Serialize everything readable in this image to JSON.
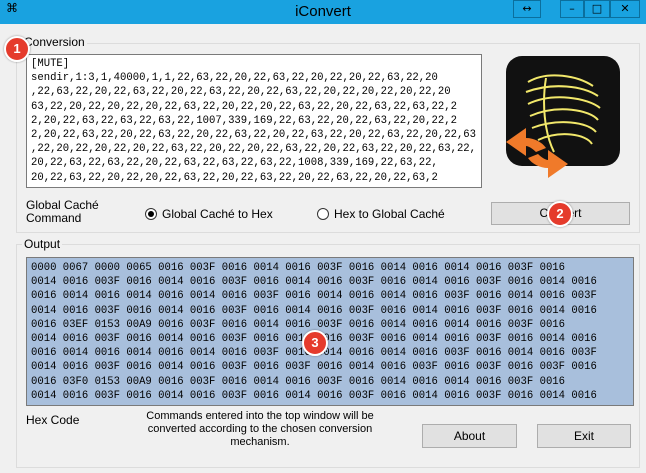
{
  "window": {
    "title": "iConvert",
    "controls": {
      "resize": "↔",
      "minimize": "–",
      "maximize": "□",
      "close": "✕"
    }
  },
  "conversion": {
    "group_label": "Conversion",
    "input_text": "[MUTE]\nsendir,1:3,1,40000,1,1,22,63,22,20,22,63,22,20,22,20,22,63,22,20\n,22,63,22,20,22,63,22,20,22,63,22,20,22,63,22,20,22,20,22,20,22,20\n63,22,20,22,20,22,20,22,63,22,20,22,20,22,63,22,20,22,63,22,63,22,2\n2,20,22,63,22,63,22,63,22,1007,339,169,22,63,22,20,22,63,22,20,22,2\n2,20,22,63,22,20,22,63,22,20,22,63,22,20,22,63,22,20,22,63,22,20,22,63\n,22,20,22,20,22,20,22,63,22,20,22,20,22,63,22,20,22,63,22,20,22,63,22,\n20,22,63,22,63,22,20,22,63,22,63,22,63,22,1008,339,169,22,63,22,\n20,22,63,22,20,22,20,22,63,22,20,22,63,22,20,22,63,22,20,22,63,2"
  },
  "options": {
    "command_label": "Global Caché\nCommand",
    "radio_to_hex": "Global Caché to Hex",
    "radio_to_gc": "Hex to Global Caché",
    "selected": "to_hex",
    "convert_button": "Convert"
  },
  "output": {
    "group_label": "Output",
    "hex_text": "0000 0067 0000 0065 0016 003F 0016 0014 0016 003F 0016 0014 0016 0014 0016 003F 0016\n0014 0016 003F 0016 0014 0016 003F 0016 0014 0016 003F 0016 0014 0016 003F 0016 0014 0016\n0016 0014 0016 0014 0016 0014 0016 003F 0016 0014 0016 0014 0016 003F 0016 0014 0016 003F\n0014 0016 003F 0016 0014 0016 003F 0016 0014 0016 003F 0016 0014 0016 003F 0016 0014 0016\n0016 03EF 0153 00A9 0016 003F 0016 0014 0016 003F 0016 0014 0016 0014 0016 003F 0016\n0014 0016 003F 0016 0014 0016 003F 0016 0014 0016 003F 0016 0014 0016 003F 0016 0014 0016\n0016 0014 0016 0014 0016 0014 0016 003F 0016 0014 0016 0014 0016 003F 0016 0014 0016 003F\n0014 0016 003F 0016 0014 0016 003F 0016 003F 0016 0014 0016 003F 0016 003F 0016 003F 0016\n0016 03F0 0153 00A9 0016 003F 0016 0014 0016 003F 0016 0014 0016 0014 0016 003F 0016\n0014 0016 003F 0016 0014 0016 003F 0016 0014 0016 003F 0016 0014 0016 003F 0016 0014 0016"
  },
  "footer": {
    "hex_code_label": "Hex Code",
    "note": "Commands entered into the top window will be converted according to the chosen conversion mechanism.",
    "about_button": "About",
    "exit_button": "Exit"
  },
  "badges": [
    "1",
    "2",
    "3"
  ],
  "colors": {
    "titlebar": "#19a2e0",
    "output_bg": "#a8bfdc",
    "badge": "#e53b2c",
    "logo_bg": "#111111",
    "logo_lines": "#f2e86b",
    "logo_arrows": "#f07a2a"
  }
}
